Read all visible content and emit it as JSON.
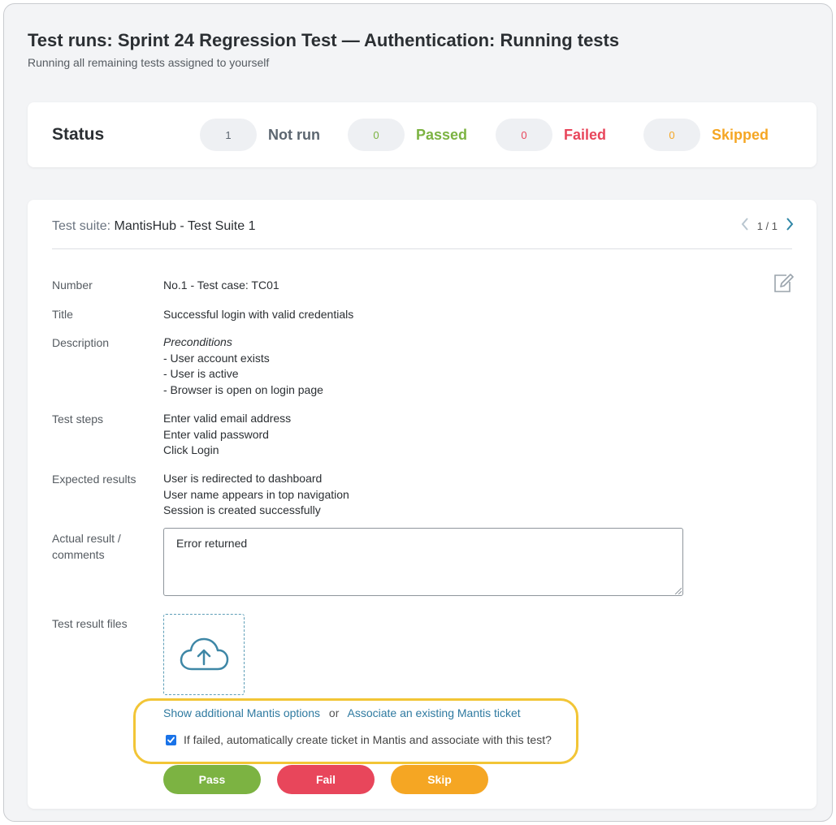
{
  "header": {
    "title": "Test runs: Sprint 24 Regression Test — Authentication: Running tests",
    "subtitle": "Running all remaining tests assigned to yourself"
  },
  "status": {
    "title": "Status",
    "items": [
      {
        "count": "1",
        "label": "Not run",
        "color": "#5c6670"
      },
      {
        "count": "0",
        "label": "Passed",
        "color": "#7cb342"
      },
      {
        "count": "0",
        "label": "Failed",
        "color": "#e8465b"
      },
      {
        "count": "0",
        "label": "Skipped",
        "color": "#f5a623"
      }
    ]
  },
  "suite": {
    "prefix": "Test suite:",
    "name": "MantisHub - Test Suite 1",
    "pager": "1 / 1"
  },
  "test_case": {
    "number_label": "Number",
    "number_value": "No.1 - Test case: TC01",
    "title_label": "Title",
    "title_value": "Successful login with valid credentials",
    "description_label": "Description",
    "description_heading": "Preconditions",
    "description_lines": [
      "- User account exists",
      "- User is active",
      "- Browser is open on login page"
    ],
    "steps_label": "Test steps",
    "steps_lines": [
      "Enter valid email address",
      "Enter valid password",
      "Click Login"
    ],
    "expected_label": "Expected results",
    "expected_lines": [
      "User is redirected to dashboard",
      "User name appears in top navigation",
      "Session is created successfully"
    ],
    "actual_label_1": "Actual result /",
    "actual_label_2": "comments",
    "actual_value": "Error returned",
    "files_label": "Test result files"
  },
  "mantis": {
    "show_options": "Show additional Mantis options",
    "or": "or",
    "associate": "Associate an existing Mantis ticket",
    "auto_ticket": "If failed, automatically create ticket in Mantis and associate with this test?",
    "auto_ticket_checked": true
  },
  "actions": {
    "pass": "Pass",
    "fail": "Fail",
    "skip": "Skip",
    "pass_color": "#7cb342",
    "fail_color": "#e8465b",
    "skip_color": "#f5a623"
  }
}
